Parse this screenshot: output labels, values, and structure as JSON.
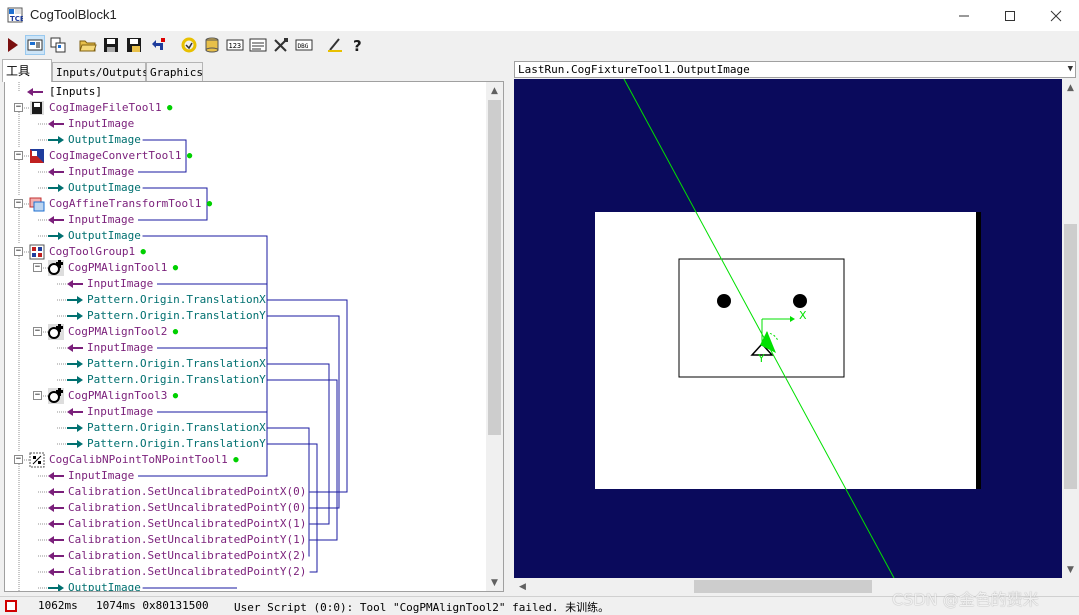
{
  "window": {
    "title": "CogToolBlock1",
    "controls": [
      "minimize-icon",
      "maximize-icon",
      "close-icon"
    ]
  },
  "toolbar": {
    "buttons": [
      {
        "name": "run-icon"
      },
      {
        "name": "show-display-icon"
      },
      {
        "name": "copy-icon"
      },
      {
        "name": "open-folder-icon"
      },
      {
        "name": "save-icon"
      },
      {
        "name": "save-as-icon"
      },
      {
        "name": "reset-icon"
      },
      {
        "name": "refresh-icon"
      },
      {
        "name": "database-icon"
      },
      {
        "name": "number-123-icon"
      },
      {
        "name": "list-icon"
      },
      {
        "name": "tools-icon"
      },
      {
        "name": "debug-icon"
      },
      {
        "name": "edit-icon"
      },
      {
        "name": "help-icon"
      }
    ]
  },
  "tabs": [
    {
      "label": "工具",
      "active": true
    },
    {
      "label": "Inputs/Outputs",
      "active": false
    },
    {
      "label": "Graphics",
      "active": false
    }
  ],
  "tree": {
    "inputs_label": "[Inputs]",
    "tools": [
      {
        "label": "CogImageFileTool1",
        "icon": "image-file-tool-icon",
        "children": [
          {
            "label": "InputImage",
            "dir": "in"
          },
          {
            "label": "OutputImage",
            "dir": "out"
          }
        ]
      },
      {
        "label": "CogImageConvertTool1",
        "icon": "image-convert-tool-icon",
        "children": [
          {
            "label": "InputImage",
            "dir": "in"
          },
          {
            "label": "OutputImage",
            "dir": "out"
          }
        ]
      },
      {
        "label": "CogAffineTransformTool1",
        "icon": "affine-transform-tool-icon",
        "children": [
          {
            "label": "InputImage",
            "dir": "in"
          },
          {
            "label": "OutputImage",
            "dir": "out"
          }
        ]
      },
      {
        "label": "CogToolGroup1",
        "icon": "tool-group-icon",
        "children": [
          {
            "label": "CogPMAlignTool1",
            "icon": "pmalign-tool-icon",
            "children": [
              {
                "label": "InputImage",
                "dir": "in"
              },
              {
                "label": "Pattern.Origin.TranslationX",
                "dir": "out"
              },
              {
                "label": "Pattern.Origin.TranslationY",
                "dir": "out"
              }
            ]
          },
          {
            "label": "CogPMAlignTool2",
            "icon": "pmalign-tool-icon",
            "children": [
              {
                "label": "InputImage",
                "dir": "in"
              },
              {
                "label": "Pattern.Origin.TranslationX",
                "dir": "out"
              },
              {
                "label": "Pattern.Origin.TranslationY",
                "dir": "out"
              }
            ]
          },
          {
            "label": "CogPMAlignTool3",
            "icon": "pmalign-tool-icon",
            "children": [
              {
                "label": "InputImage",
                "dir": "in"
              },
              {
                "label": "Pattern.Origin.TranslationX",
                "dir": "out"
              },
              {
                "label": "Pattern.Origin.TranslationY",
                "dir": "out"
              }
            ]
          }
        ]
      },
      {
        "label": "CogCalibNPointToNPointTool1",
        "icon": "calib-npoint-tool-icon",
        "children": [
          {
            "label": "InputImage",
            "dir": "in"
          },
          {
            "label": "Calibration.SetUncalibratedPointX(0)",
            "dir": "in"
          },
          {
            "label": "Calibration.SetUncalibratedPointY(0)",
            "dir": "in"
          },
          {
            "label": "Calibration.SetUncalibratedPointX(1)",
            "dir": "in"
          },
          {
            "label": "Calibration.SetUncalibratedPointY(1)",
            "dir": "in"
          },
          {
            "label": "Calibration.SetUncalibratedPointX(2)",
            "dir": "in"
          },
          {
            "label": "Calibration.SetUncalibratedPointY(2)",
            "dir": "in"
          },
          {
            "label": "OutputImage",
            "dir": "out"
          }
        ]
      }
    ]
  },
  "image_panel": {
    "selector_value": "LastRun.CogFixtureTool1.OutputImage",
    "axis_x_label": "X",
    "axis_y_label": "Y"
  },
  "status": {
    "time1": "1062ms",
    "time2": "1074ms 0x80131500",
    "message": "User Script (0:0): Tool \"CogPMAlignTool2\" failed. 未训练。"
  },
  "watermark": "CSDN @金色的费米",
  "colors": {
    "input_arrow": "#7a1f7a",
    "output_arrow": "#007070",
    "link_line": "#1a1aa0",
    "display_bg": "#0a0a5c",
    "graphic_green": "#00e000",
    "ok_dot": "#00d000",
    "status_error": "#d00000"
  }
}
